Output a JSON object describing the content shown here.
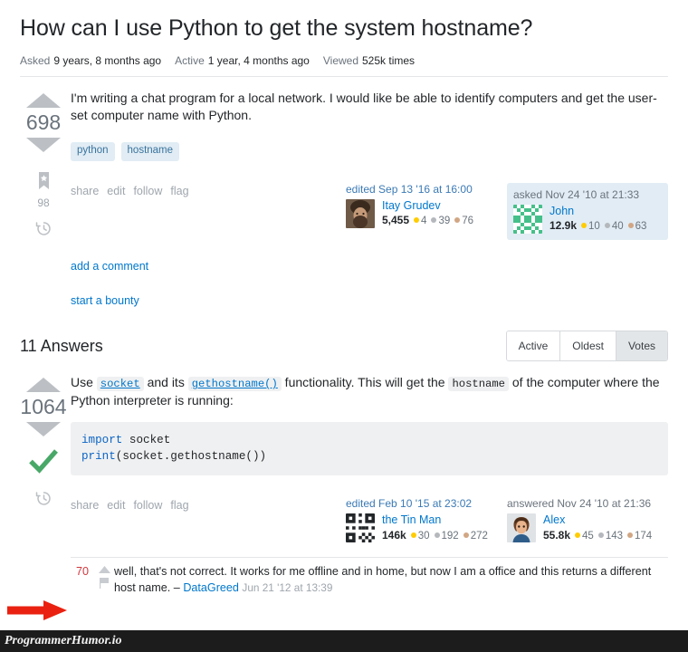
{
  "question": {
    "title": "How can I use Python to get the system hostname?",
    "stats": [
      {
        "label": "Asked",
        "value": "9 years, 8 months ago"
      },
      {
        "label": "Active",
        "value": "1 year, 4 months ago"
      },
      {
        "label": "Viewed",
        "value": "525k times"
      }
    ],
    "votes": "698",
    "bookmarks": "98",
    "body": "I'm writing a chat program for a local network. I would like be able to identify computers and get the user-set computer name with Python.",
    "tags": [
      "python",
      "hostname"
    ],
    "actions": [
      "share",
      "edit",
      "follow",
      "flag"
    ],
    "editor": {
      "when": "edited Sep 13 '16 at 16:00",
      "name": "Itay Grudev",
      "rep": "5,455",
      "gold": "4",
      "silver": "39",
      "bronze": "76"
    },
    "owner": {
      "when": "asked Nov 24 '10 at 21:33",
      "name": "John",
      "rep": "12.9k",
      "gold": "10",
      "silver": "40",
      "bronze": "63"
    },
    "add_comment": "add a comment",
    "start_bounty": "start a bounty"
  },
  "answers_header": {
    "title": "11 Answers",
    "sort_tabs": [
      {
        "label": "Active",
        "selected": false
      },
      {
        "label": "Oldest",
        "selected": false
      },
      {
        "label": "Votes",
        "selected": true
      }
    ]
  },
  "answer": {
    "votes": "1064",
    "accepted": true,
    "text_1": "Use ",
    "link_1": "socket",
    "text_2": " and its ",
    "link_2": "gethostname()",
    "text_3": " functionality. This will get the ",
    "code_1": "hostname",
    "text_4": " of the computer where the Python interpreter is running:",
    "code_block": {
      "line1_kw": "import",
      "line1_rest": " socket",
      "line2_kw": "print",
      "line2_rest": "(socket.gethostname())"
    },
    "actions": [
      "share",
      "edit",
      "follow",
      "flag"
    ],
    "editor": {
      "when": "edited Feb 10 '15 at 23:02",
      "name": "the Tin Man",
      "rep": "146k",
      "gold": "30",
      "silver": "192",
      "bronze": "272"
    },
    "owner": {
      "when": "answered Nov 24 '10 at 21:36",
      "name": "Alex",
      "rep": "55.8k",
      "gold": "45",
      "silver": "143",
      "bronze": "174"
    },
    "comment": {
      "score": "70",
      "body": "well, that's not correct. It works for me offline and in home, but now I am a office and this returns a different host name. – ",
      "user": "DataGreed",
      "date": "Jun 21 '12 at 13:39"
    }
  },
  "annotation": {
    "arrow_color": "#ea2110"
  },
  "watermark": {
    "text": "ProgrammerHumor.io"
  },
  "colors": {
    "link": "#0077cc",
    "tag_bg": "#e1ecf4",
    "tag_text": "#39739d",
    "accepted_green": "#48a868",
    "comment_score": "#d1383d"
  }
}
